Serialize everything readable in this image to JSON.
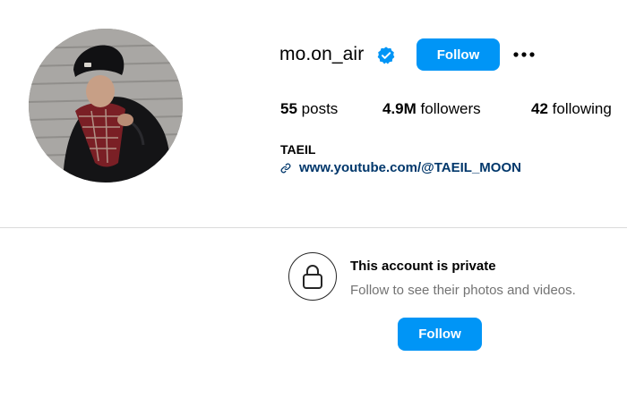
{
  "profile": {
    "handle": "mo.on_air",
    "verified": true,
    "follow_label": "Follow",
    "more_icon": "more-options-icon",
    "avatar_alt": "profile photo",
    "stats": {
      "posts_count": "55",
      "posts_label": "posts",
      "followers_count": "4.9M",
      "followers_label": "followers",
      "following_count": "42",
      "following_label": "following"
    },
    "bio": {
      "name": "TAEIL",
      "link_text": "www.youtube.com/@TAEIL_MOON",
      "link_icon": "link-icon"
    }
  },
  "private_notice": {
    "icon": "lock-icon",
    "title": "This account is private",
    "subtitle": "Follow to see their photos and videos.",
    "follow_label": "Follow"
  },
  "colors": {
    "accent": "#0095f6",
    "verified": "#0095f6",
    "link": "#00376b",
    "muted_text": "#737373",
    "divider": "#dbdbdb"
  }
}
